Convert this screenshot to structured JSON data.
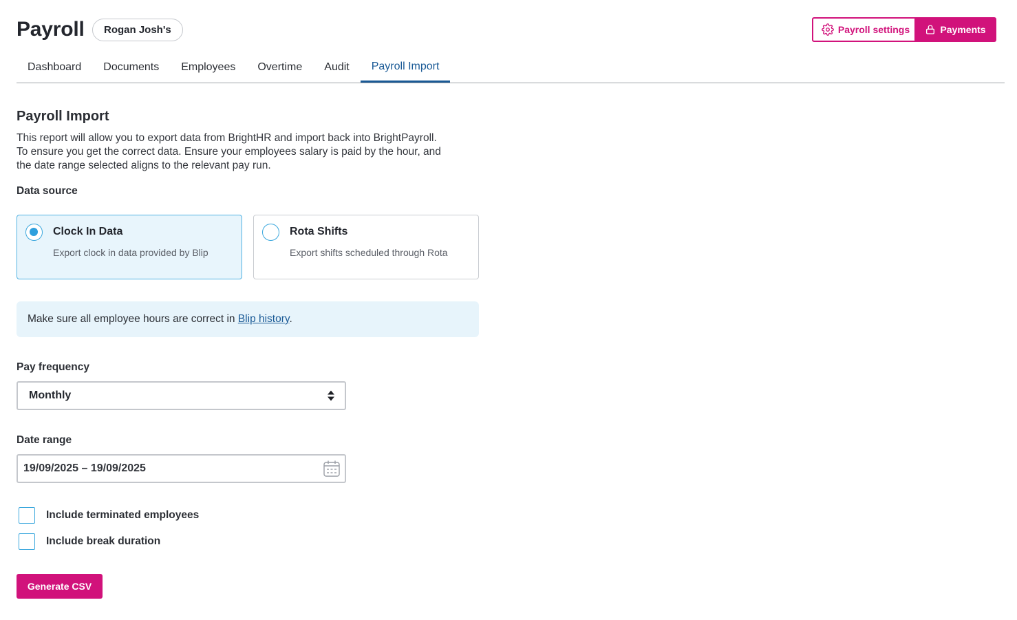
{
  "header": {
    "title": "Payroll",
    "company": "Rogan Josh's",
    "settings_label": "Payroll settings",
    "payments_label": "Payments"
  },
  "tabs": [
    {
      "label": "Dashboard",
      "active": false
    },
    {
      "label": "Documents",
      "active": false
    },
    {
      "label": "Employees",
      "active": false
    },
    {
      "label": "Overtime",
      "active": false
    },
    {
      "label": "Audit",
      "active": false
    },
    {
      "label": "Payroll Import",
      "active": true
    }
  ],
  "main": {
    "title": "Payroll Import",
    "description": [
      "This report will allow you to export data from BrightHR and import back into BrightPayroll.",
      "To ensure you get the correct data. Ensure your employees salary is paid by the hour, and",
      "the date range selected aligns to the relevant pay run."
    ],
    "data_source_label": "Data source",
    "sources": [
      {
        "title": "Clock In Data",
        "subtitle": "Export clock in data provided by Blip",
        "selected": true
      },
      {
        "title": "Rota Shifts",
        "subtitle": "Export shifts scheduled through Rota",
        "selected": false
      }
    ],
    "info": {
      "prefix": "Make sure all employee hours are correct in ",
      "link": "Blip history",
      "suffix": "."
    },
    "pay_frequency_label": "Pay frequency",
    "pay_frequency_value": "Monthly",
    "date_range_label": "Date range",
    "date_range_value": "19/09/2025 – 19/09/2025",
    "checkboxes": [
      {
        "label": "Include terminated employees",
        "checked": false
      },
      {
        "label": "Include break duration",
        "checked": false
      }
    ],
    "generate_label": "Generate CSV"
  },
  "colors": {
    "brand": "#d1127b",
    "link": "#1a5a96",
    "accent": "#2e9fdd",
    "info_bg": "#e7f4fb"
  }
}
